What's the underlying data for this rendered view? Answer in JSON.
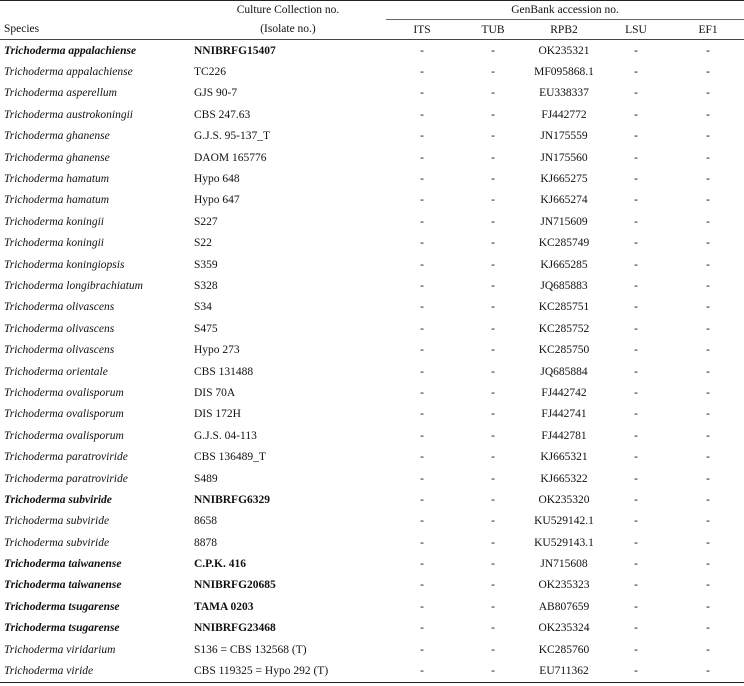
{
  "header": {
    "species": "Species",
    "culture_collection": "Culture Collection no.",
    "isolate": "(Isolate no.)",
    "genbank": "GenBank accession no.",
    "columns": [
      "ITS",
      "TUB",
      "RPB2",
      "LSU",
      "EF1"
    ]
  },
  "rows": [
    {
      "species": "Trichoderma appalachiense",
      "isolate": "NNIBRFG15407",
      "bold": true,
      "its": "-",
      "tub": "-",
      "rpb2": "OK235321",
      "lsu": "-",
      "ef1": "-"
    },
    {
      "species": "Trichoderma appalachiense",
      "isolate": "TC226",
      "bold": false,
      "its": "-",
      "tub": "-",
      "rpb2": "MF095868.1",
      "lsu": "-",
      "ef1": "-"
    },
    {
      "species": "Trichoderma asperellum",
      "isolate": "GJS 90-7",
      "bold": false,
      "its": "-",
      "tub": "-",
      "rpb2": "EU338337",
      "lsu": "-",
      "ef1": "-"
    },
    {
      "species": "Trichoderma austrokoningii",
      "isolate": "CBS 247.63",
      "bold": false,
      "its": "-",
      "tub": "-",
      "rpb2": "FJ442772",
      "lsu": "-",
      "ef1": "-"
    },
    {
      "species": "Trichoderma ghanense",
      "isolate": "G.J.S. 95-137_T",
      "bold": false,
      "its": "-",
      "tub": "-",
      "rpb2": "JN175559",
      "lsu": "-",
      "ef1": "-"
    },
    {
      "species": "Trichoderma ghanense",
      "isolate": "DAOM 165776",
      "bold": false,
      "its": "-",
      "tub": "-",
      "rpb2": "JN175560",
      "lsu": "-",
      "ef1": "-"
    },
    {
      "species": "Trichoderma hamatum",
      "isolate": "Hypo 648",
      "bold": false,
      "its": "-",
      "tub": "-",
      "rpb2": "KJ665275",
      "lsu": "-",
      "ef1": "-"
    },
    {
      "species": "Trichoderma hamatum",
      "isolate": "Hypo 647",
      "bold": false,
      "its": "-",
      "tub": "-",
      "rpb2": "KJ665274",
      "lsu": "-",
      "ef1": "-"
    },
    {
      "species": "Trichoderma koningii",
      "isolate": "S227",
      "bold": false,
      "its": "-",
      "tub": "-",
      "rpb2": "JN715609",
      "lsu": "-",
      "ef1": "-"
    },
    {
      "species": "Trichoderma koningii",
      "isolate": "S22",
      "bold": false,
      "its": "-",
      "tub": "-",
      "rpb2": "KC285749",
      "lsu": "-",
      "ef1": "-"
    },
    {
      "species": "Trichoderma koningiopsis",
      "isolate": "S359",
      "bold": false,
      "its": "-",
      "tub": "-",
      "rpb2": "KJ665285",
      "lsu": "-",
      "ef1": "-"
    },
    {
      "species": "Trichoderma longibrachiatum",
      "isolate": "S328",
      "bold": false,
      "its": "-",
      "tub": "-",
      "rpb2": "JQ685883",
      "lsu": "-",
      "ef1": "-"
    },
    {
      "species": "Trichoderma olivascens",
      "isolate": "S34",
      "bold": false,
      "its": "-",
      "tub": "-",
      "rpb2": "KC285751",
      "lsu": "-",
      "ef1": "-"
    },
    {
      "species": "Trichoderma olivascens",
      "isolate": "S475",
      "bold": false,
      "its": "-",
      "tub": "-",
      "rpb2": "KC285752",
      "lsu": "-",
      "ef1": "-"
    },
    {
      "species": "Trichoderma olivascens",
      "isolate": "Hypo 273",
      "bold": false,
      "its": "-",
      "tub": "-",
      "rpb2": "KC285750",
      "lsu": "-",
      "ef1": "-"
    },
    {
      "species": "Trichoderma orientale",
      "isolate": "CBS 131488",
      "bold": false,
      "its": "-",
      "tub": "-",
      "rpb2": "JQ685884",
      "lsu": "-",
      "ef1": "-"
    },
    {
      "species": "Trichoderma ovalisporum",
      "isolate": "DIS 70A",
      "bold": false,
      "its": "-",
      "tub": "-",
      "rpb2": "FJ442742",
      "lsu": "-",
      "ef1": "-"
    },
    {
      "species": "Trichoderma ovalisporum",
      "isolate": "DIS 172H",
      "bold": false,
      "its": "-",
      "tub": "-",
      "rpb2": "FJ442741",
      "lsu": "-",
      "ef1": "-"
    },
    {
      "species": "Trichoderma ovalisporum",
      "isolate": "G.J.S. 04-113",
      "bold": false,
      "its": "-",
      "tub": "-",
      "rpb2": "FJ442781",
      "lsu": "-",
      "ef1": "-"
    },
    {
      "species": "Trichoderma paratroviride",
      "isolate": "CBS 136489_T",
      "bold": false,
      "its": "-",
      "tub": "-",
      "rpb2": "KJ665321",
      "lsu": "-",
      "ef1": "-"
    },
    {
      "species": "Trichoderma paratroviride",
      "isolate": "S489",
      "bold": false,
      "its": "-",
      "tub": "-",
      "rpb2": "KJ665322",
      "lsu": "-",
      "ef1": "-"
    },
    {
      "species": "Trichoderma subviride",
      "isolate": "NNIBRFG6329",
      "bold": true,
      "its": "-",
      "tub": "-",
      "rpb2": "OK235320",
      "lsu": "-",
      "ef1": "-"
    },
    {
      "species": "Trichoderma subviride",
      "isolate": "8658",
      "bold": false,
      "its": "-",
      "tub": "-",
      "rpb2": "KU529142.1",
      "lsu": "-",
      "ef1": "-"
    },
    {
      "species": "Trichoderma subviride",
      "isolate": "8878",
      "bold": false,
      "its": "-",
      "tub": "-",
      "rpb2": "KU529143.1",
      "lsu": "-",
      "ef1": "-"
    },
    {
      "species": "Trichoderma taiwanense",
      "isolate": "C.P.K. 416",
      "bold": true,
      "its": "-",
      "tub": "-",
      "rpb2": "JN715608",
      "lsu": "-",
      "ef1": "-"
    },
    {
      "species": "Trichoderma taiwanense",
      "isolate": "NNIBRFG20685",
      "bold": true,
      "its": "-",
      "tub": "-",
      "rpb2": "OK235323",
      "lsu": "-",
      "ef1": "-"
    },
    {
      "species": "Trichoderma tsugarense",
      "isolate": "TAMA 0203",
      "bold": true,
      "its": "-",
      "tub": "-",
      "rpb2": "AB807659",
      "lsu": "-",
      "ef1": "-"
    },
    {
      "species": "Trichoderma tsugarense",
      "isolate": "NNIBRFG23468",
      "bold": true,
      "its": "-",
      "tub": "-",
      "rpb2": "OK235324",
      "lsu": "-",
      "ef1": "-"
    },
    {
      "species": "Trichoderma viridarium",
      "isolate": "S136 = CBS 132568 (T)",
      "bold": false,
      "its": "-",
      "tub": "-",
      "rpb2": "KC285760",
      "lsu": "-",
      "ef1": "-"
    },
    {
      "species": "Trichoderma viride",
      "isolate": "CBS 119325 = Hypo 292 (T)",
      "bold": false,
      "its": "-",
      "tub": "-",
      "rpb2": "EU711362",
      "lsu": "-",
      "ef1": "-"
    }
  ]
}
